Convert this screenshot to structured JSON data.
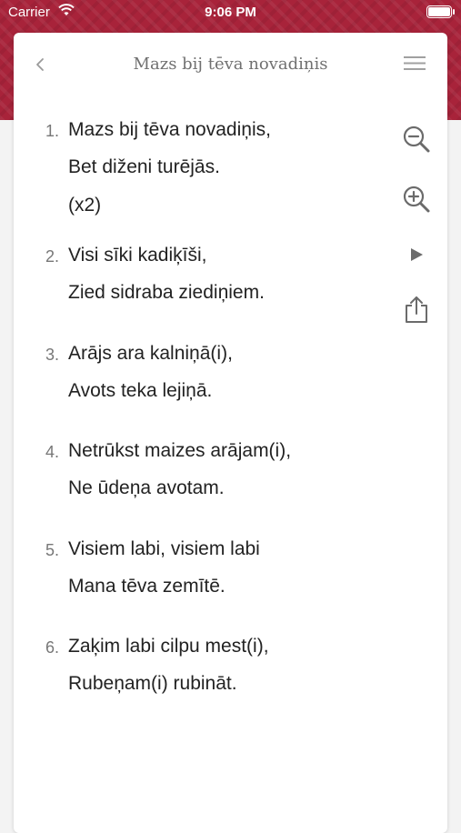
{
  "status_bar": {
    "carrier": "Carrier",
    "time": "9:06 PM"
  },
  "header": {
    "title": "Mazs bij tēva novadiņis"
  },
  "icons": {
    "back": "chevron-left-icon",
    "menu": "hamburger-menu-icon",
    "zoom_out": "zoom-out-icon",
    "zoom_in": "zoom-in-icon",
    "play": "play-icon",
    "share": "share-icon"
  },
  "colors": {
    "brand": "#a8233a",
    "text": "#222222",
    "muted": "#777777"
  },
  "verses": [
    {
      "number": "1.",
      "lines": [
        "Mazs bij tēva novadiņis,",
        "Bet diženi turējās.",
        "(x2)"
      ]
    },
    {
      "number": "2.",
      "lines": [
        "Visi sīki kadiķīši,",
        "Zied sidraba ziediņiem."
      ]
    },
    {
      "number": "3.",
      "lines": [
        "Arājs ara kalniņā(i),",
        "Avots teka lejiņā."
      ]
    },
    {
      "number": "4.",
      "lines": [
        "Netrūkst maizes arājam(i),",
        "Ne ūdeņa avotam."
      ]
    },
    {
      "number": "5.",
      "lines": [
        "Visiem labi, visiem labi",
        "Mana tēva zemītē."
      ]
    },
    {
      "number": "6.",
      "lines": [
        "Zaķim labi cilpu mest(i),",
        "Rubeņam(i) rubināt."
      ]
    }
  ]
}
